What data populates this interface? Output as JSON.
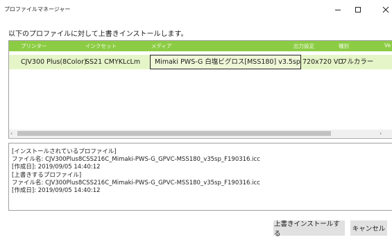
{
  "window": {
    "title": "プロファイルマネージャー",
    "minimize_icon": "minimize-icon",
    "maximize_icon": "maximize-icon",
    "close_icon": "close-icon"
  },
  "instruction": "以下のプロファイルに対して上書きインストールします。",
  "table": {
    "columns": [
      "プリンター",
      "インクセット",
      "メディア",
      "出力設定",
      "種別",
      "Ve"
    ],
    "rows": [
      {
        "printer": "CJV300 Plus(8Color)",
        "inkset": "SS21 CMYKLcLm",
        "media": "Mimaki PWS-G 白塩ビグロス[MSS180] v3.5sp",
        "output": "720x720 VD",
        "type": "フルカラー",
        "version": ""
      }
    ],
    "scroll_left_icon": "chevron-left-icon",
    "scroll_right_icon": "chevron-right-icon"
  },
  "info": {
    "lines": [
      "[インストールされているプロファイル]",
      "ファイル名: CJV300Plus8CSS216C_Mimaki-PWS-G_GPVC-MSS180_v35sp_F190316.icc",
      "[作成日]: 2019/09/05 14:40:12",
      "[上書きするプロファイル]",
      "ファイル名: CJV300Plus8CSS216C_Mimaki-PWS-G_GPVC-MSS180_v35sp_F190316.icc",
      "[作成日]: 2019/09/05 14:40:12"
    ]
  },
  "buttons": {
    "overwrite": "上書きインストールする",
    "cancel": "キャンセル"
  },
  "colors": {
    "header_green": "#8ccc44",
    "selected_row": "#e6f5c8",
    "button_gray": "#e1e1e1"
  }
}
